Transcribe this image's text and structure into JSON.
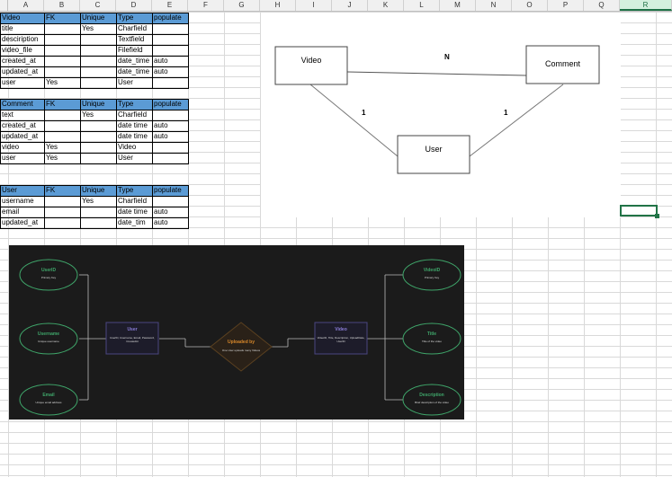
{
  "columns": [
    "A",
    "B",
    "C",
    "D",
    "E",
    "F",
    "G",
    "H",
    "I",
    "J",
    "K",
    "L",
    "M",
    "N",
    "O",
    "P",
    "Q",
    "R"
  ],
  "selected_column": "R",
  "video_table": {
    "headers": [
      "Video",
      "FK",
      "Unique",
      "Type",
      "populate"
    ],
    "rows": [
      [
        "title",
        "",
        "Yes",
        "Charfield",
        ""
      ],
      [
        "desciription",
        "",
        "",
        "Textfield",
        ""
      ],
      [
        "video_file",
        "",
        "",
        "Filefield",
        ""
      ],
      [
        "created_at",
        "",
        "",
        "date_time",
        "auto"
      ],
      [
        "updated_at",
        "",
        "",
        "date_time",
        "auto"
      ],
      [
        "user",
        "Yes",
        "",
        "User",
        ""
      ]
    ]
  },
  "comment_table": {
    "headers": [
      "Comment",
      "FK",
      "Unique",
      "Type",
      "populate"
    ],
    "rows": [
      [
        "text",
        "",
        "Yes",
        "Charfield",
        ""
      ],
      [
        "created_at",
        "",
        "",
        "date time",
        "auto"
      ],
      [
        "updated_at",
        "",
        "",
        "date time",
        "auto"
      ],
      [
        "video",
        "Yes",
        "",
        "Video",
        ""
      ],
      [
        "user",
        "Yes",
        "",
        "User",
        ""
      ]
    ]
  },
  "user_table": {
    "headers": [
      "User",
      "FK",
      "Unique",
      "Type",
      "populate"
    ],
    "rows": [
      [
        "username",
        "",
        "Yes",
        "Charfield",
        ""
      ],
      [
        "email",
        "",
        "",
        "date time",
        "auto"
      ],
      [
        "updated_at",
        "",
        "",
        "date_tim",
        "auto"
      ]
    ]
  },
  "er_diagram": {
    "video": "Video",
    "comment": "Comment",
    "user": "User",
    "rel_video_comment": "N",
    "rel_video_user": "1",
    "rel_comment_user": "1"
  },
  "dark_diagram": {
    "left_nodes": [
      {
        "title": "UserID",
        "sub": "Primary Key"
      },
      {
        "title": "Username",
        "sub": "Unique username"
      },
      {
        "title": "Email",
        "sub": "Unique email address"
      }
    ],
    "user_box": {
      "title": "User",
      "sub": "UserID, Username, Email, Password, CreatedAt"
    },
    "relation": {
      "title": "Uploaded by",
      "sub": "One User uploads many Videos"
    },
    "video_box": {
      "title": "Video",
      "sub": "VideoID, Title, Description, UploadDate, UserID"
    },
    "right_nodes": [
      {
        "title": "VideoID",
        "sub": "Primary Key"
      },
      {
        "title": "Title",
        "sub": "Title of the video"
      },
      {
        "title": "Description",
        "sub": "Brief description of the video"
      }
    ],
    "colors": {
      "green": "#3fa66a",
      "purple": "#8a7dd8",
      "orange": "#d9882a",
      "bg": "#1b1b1b"
    }
  }
}
